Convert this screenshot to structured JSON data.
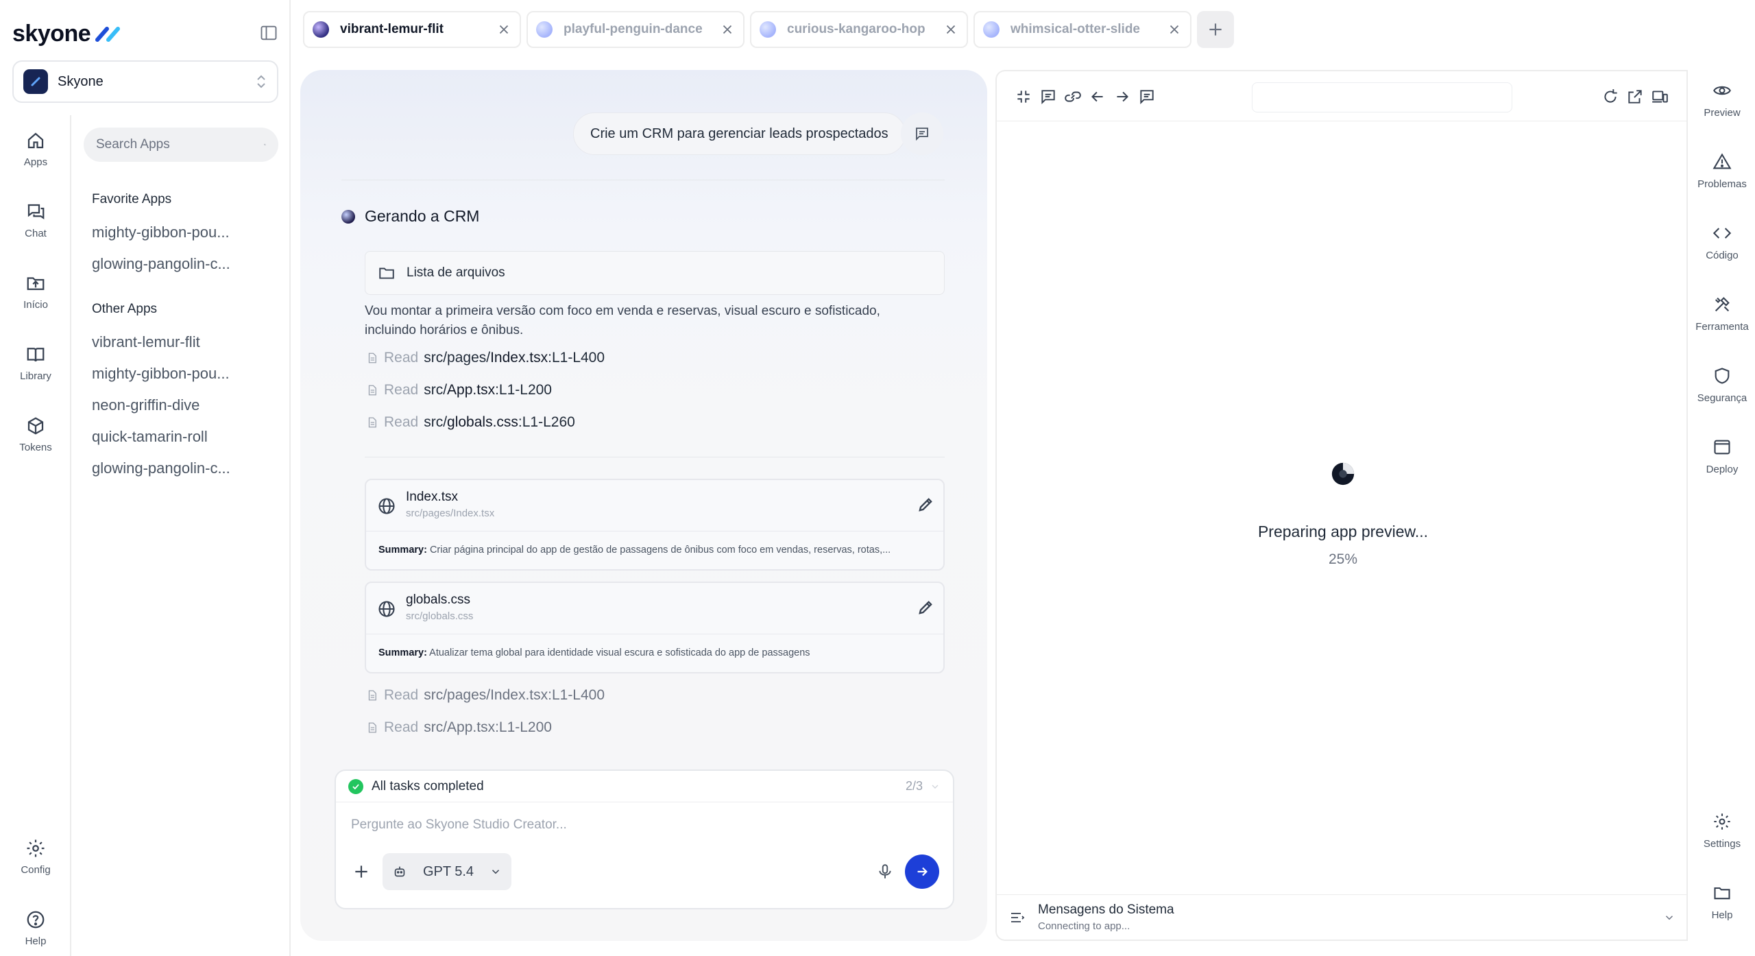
{
  "brand": {
    "name": "skyone"
  },
  "workspace": {
    "name": "Skyone"
  },
  "rail": [
    {
      "label": "Apps",
      "icon": "home-icon"
    },
    {
      "label": "Chat",
      "icon": "chat-icon"
    },
    {
      "label": "Início",
      "icon": "upload-folder-icon"
    },
    {
      "label": "Library",
      "icon": "book-icon"
    },
    {
      "label": "Tokens",
      "icon": "cube-icon"
    }
  ],
  "rail_bottom": [
    {
      "label": "Config",
      "icon": "gear-icon"
    },
    {
      "label": "Help",
      "icon": "help-icon"
    }
  ],
  "search": {
    "placeholder": "Search Apps"
  },
  "favorite_apps": {
    "title": "Favorite Apps",
    "items": [
      "mighty-gibbon-pou...",
      "glowing-pangolin-c..."
    ]
  },
  "other_apps": {
    "title": "Other Apps",
    "items": [
      "vibrant-lemur-flit",
      "mighty-gibbon-pou...",
      "neon-griffin-dive",
      "quick-tamarin-roll",
      "glowing-pangolin-c..."
    ]
  },
  "tabs": [
    {
      "label": "vibrant-lemur-flit",
      "active": true
    },
    {
      "label": "playful-penguin-dance",
      "active": false
    },
    {
      "label": "curious-kangaroo-hop",
      "active": false
    },
    {
      "label": "whimsical-otter-slide",
      "active": false
    }
  ],
  "chat": {
    "user_message": "Crie um CRM para gerenciar leads prospectados",
    "generating_title": "Gerando a CRM",
    "file_list_label": "Lista de arquivos",
    "paragraph": "Vou montar a primeira versão com foco em venda e reservas, visual escuro e sofisticado, incluindo horários e ônibus.",
    "read_verb": "Read",
    "reads": [
      {
        "prefix": "src/pages/",
        "file": "Index.tsx",
        "range": ":L1-L400"
      },
      {
        "prefix": "src/",
        "file": "App.tsx",
        "range": ":L1-L200"
      },
      {
        "prefix": "src/",
        "file": "globals.css",
        "range": ":L1-L260"
      }
    ],
    "files": [
      {
        "name": "Index.tsx",
        "path": "src/pages/Index.tsx",
        "summary_label": "Summary:",
        "summary": "Criar página principal do app de gestão de passagens de ônibus com foco em vendas, reservas, rotas,..."
      },
      {
        "name": "globals.css",
        "path": "src/globals.css",
        "summary_label": "Summary:",
        "summary": "Atualizar tema global para identidade visual escura e sofisticada do app de passagens"
      }
    ],
    "reads_after": [
      {
        "text": "src/pages/Index.tsx:L1-L400"
      },
      {
        "text": "src/App.tsx:L1-L200"
      }
    ]
  },
  "composer": {
    "tasks_label": "All tasks completed",
    "tasks_count": "2/3",
    "placeholder": "Pergunte ao Skyone Studio Creator...",
    "model": "GPT 5.4"
  },
  "preview": {
    "loading_text": "Preparing app preview...",
    "progress": "25%",
    "system_messages_title": "Mensagens do Sistema",
    "system_messages_status": "Connecting to app..."
  },
  "right_rail": [
    {
      "label": "Preview",
      "icon": "eye-icon"
    },
    {
      "label": "Problemas",
      "icon": "warning-icon"
    },
    {
      "label": "Código",
      "icon": "code-icon"
    },
    {
      "label": "Ferramenta",
      "icon": "tools-icon"
    },
    {
      "label": "Segurança",
      "icon": "shield-icon"
    },
    {
      "label": "Deploy",
      "icon": "window-icon"
    }
  ],
  "right_rail_bottom": [
    {
      "label": "Settings",
      "icon": "gear-icon"
    },
    {
      "label": "Help",
      "icon": "folder-icon"
    }
  ],
  "colors": {
    "accent": "#1d3fd8",
    "success": "#22c55e",
    "brand_dark": "#0b1020"
  }
}
